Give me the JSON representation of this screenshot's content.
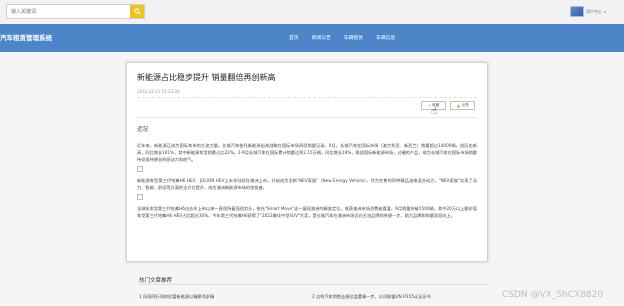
{
  "search": {
    "placeholder": "输入关键词"
  },
  "user": {
    "name": "用户中心"
  },
  "header": {
    "logo": "汽车租赁管理系统",
    "nav": [
      "首页",
      "新闻公告",
      "车辆租赁",
      "车辆信息"
    ]
  },
  "article": {
    "title": "新能源占比稳步提升 销量翻倍再创新高",
    "date": "2022-12-11 15:23:30",
    "collect_label": "收藏",
    "like_label": "点赞",
    "section_title": "近况",
    "paragraphs": [
      "近年来，新能源正成为国际车市的主流力量。长城汽车依托新能源出海战略在国际市场再续销量记录。9月，长城汽车在国际市场（澳大利亚、新西兰）销量超过14000辆，创历史新高，同比增长101%，其中新能源车型销量占比22%。1-9月长城汽车在国际累计销量达到2.15万辆，同比增长19%，稳居国际新能源市场，过硬的产品，成为长城汽车在国际市场销量持续保持增长的驱动力和底气。",
      "新能源车型第三代哈弗H6 HEV、JOLION HEV上半年陆续在澳洲上市，开始成为全新\"NEV家族\"（New Energy Vehicle），作为在售的四种精品油电混合动力，\"NEV家族\"实现了动力、智能、舒适等方面的全方位提升，成为澳洲新能源市场的佼佼者。",
      "全球化车型第三代哈弗H6自去年上市以来一直保持着强劲势头，依托\"Smart Move\"这一展现澳洲的精准定位，收获澳洲市场消费者喜爱。9月销量突破1500辆，其中20万以上额价值车型第三代哈弗H6 HEV占比超过30%。今年第三代哈弗H6获得了\"2022最佳中型SUV\"大奖，是长城汽车在澳洲市场迈向主流品牌的关键一步，助力品牌和销量双双向上。"
    ]
  },
  "recommended": {
    "title": "热门文章推荐",
    "items": [
      "1  风雨同行同的民富新能源以精耕而求精",
      "2  吉利汽车销售业绩总监董事一步，公司联盟UN R155认证证书"
    ]
  },
  "watermark": "CSDN @VX_ShCX8820"
}
